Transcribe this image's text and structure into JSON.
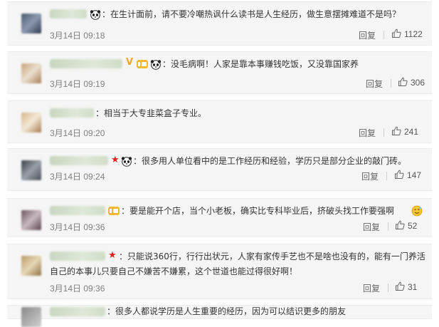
{
  "comments": [
    {
      "text": "：在生计面前，请不要冷嘲热讽什么读书是人生经历，做生意摆摊难道不是吗？",
      "time": "3月14日 09:18",
      "reply": "回复",
      "likes": "1122"
    },
    {
      "text": "：没毛病啊！人家是靠本事赚钱吃饭，又没靠国家养",
      "time": "3月14日 09:19",
      "reply": "回复",
      "likes": "306"
    },
    {
      "text": "：相当于大专韭菜盒子专业。",
      "time": "3月14日 09:20",
      "reply": "回复",
      "likes": "241"
    },
    {
      "text": "：很多用人单位看中的是工作经历和经验，学历只是部分企业的敲门砖。",
      "time": "3月14日 09:24",
      "reply": "回复",
      "likes": "147"
    },
    {
      "text": "：要是能开个店，当个小老板，确实比专科毕业后，挤破头找工作要强啊",
      "time": "3月14日 09:36",
      "reply": "回复",
      "likes": "52"
    },
    {
      "text": "：只能说360行，行行出状元，人家有家传手艺也不是啥也没有的，能有一门养活",
      "text2": "自己的本事儿只要自己不嫌苦不嫌累，这个世道也能过得很好啊！",
      "time": "3月14日 09:36",
      "reply": "回复",
      "likes": "31"
    },
    {
      "text": "：很多人都说学历是人生重要的经历，因为可以结识更多的朋友"
    }
  ],
  "colors": {
    "card_bg": "#f5f5f5",
    "text": "#333333",
    "timestamp": "#808080",
    "badge_star": "#e0211c",
    "badge_v": "#f5a623"
  },
  "icons": [
    "panda-emoji-icon",
    "v-badge-icon",
    "star-badge-icon",
    "thumbs-up-icon",
    "sweat-smile-emoji-icon"
  ]
}
